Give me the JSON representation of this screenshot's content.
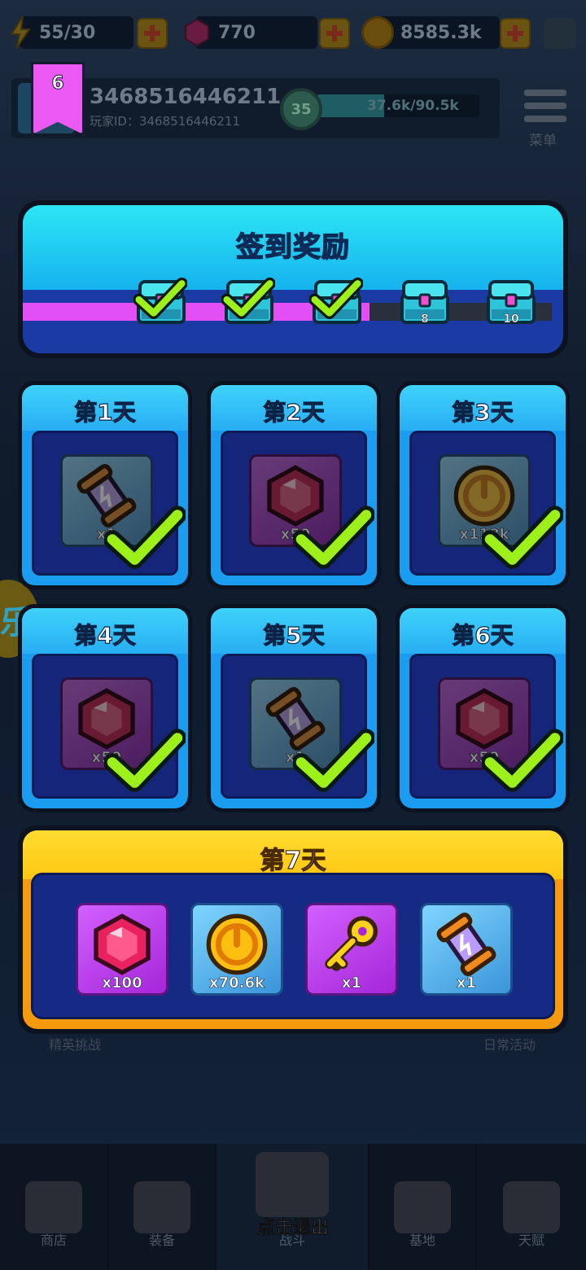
{
  "resources": {
    "energy": "55/30",
    "gems": "770",
    "coins": "8585.3k"
  },
  "profile": {
    "name": "3468516446211",
    "id_line": "玩家ID：3468516446211",
    "level": "35",
    "xp": "37.6k/90.5k",
    "xp_fraction": 0.415
  },
  "menu_label": "菜单",
  "dialog": {
    "title": "签到奖励",
    "progress_days": "6",
    "progress_fraction": 0.655,
    "milestones": [
      {
        "claimed": true,
        "label": ""
      },
      {
        "claimed": true,
        "label": ""
      },
      {
        "claimed": true,
        "label": ""
      },
      {
        "claimed": false,
        "label": "8"
      },
      {
        "claimed": false,
        "label": "10"
      }
    ],
    "days": [
      {
        "label": "第1天",
        "item": "energy-canister-icon",
        "amount": "x1",
        "claimed": true
      },
      {
        "label": "第2天",
        "item": "gem-icon",
        "amount": "x50",
        "claimed": true
      },
      {
        "label": "第3天",
        "item": "coin-icon",
        "amount": "x118k",
        "claimed": true
      },
      {
        "label": "第4天",
        "item": "gem-icon",
        "amount": "x50",
        "claimed": true
      },
      {
        "label": "第5天",
        "item": "energy-canister-icon",
        "amount": "x1",
        "claimed": true
      },
      {
        "label": "第6天",
        "item": "gem-icon",
        "amount": "x50",
        "claimed": true
      }
    ],
    "day7": {
      "label": "第7天",
      "rewards": [
        {
          "item": "gem-icon",
          "amount": "x100",
          "tile": "purple"
        },
        {
          "item": "coin-icon",
          "amount": "x70.6k",
          "tile": "blue"
        },
        {
          "item": "key-icon",
          "amount": "x1",
          "tile": "purple"
        },
        {
          "item": "energy-canister-icon",
          "amount": "x1",
          "tile": "blue"
        }
      ]
    },
    "exit_hint": "点击退出"
  },
  "background_labels": {
    "elite": "精英挑战",
    "daily": "日常活动"
  },
  "bottom_nav": [
    {
      "label": "商店"
    },
    {
      "label": "装备"
    },
    {
      "label": "战斗"
    },
    {
      "label": "基地"
    },
    {
      "label": "天赋"
    }
  ],
  "colors": {
    "accent_cyan": "#2ce6f4",
    "check_green": "#9ef01a",
    "progress_pink": "#e24ff5",
    "day7_gold": "#ffc712"
  }
}
